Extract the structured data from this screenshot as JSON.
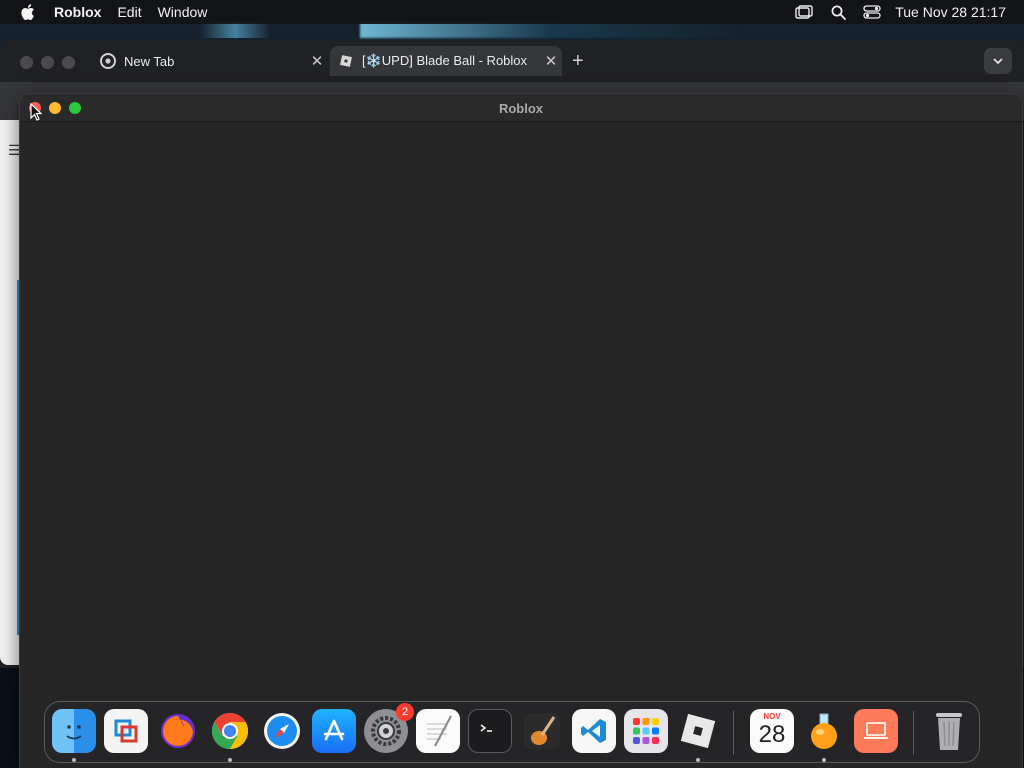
{
  "menubar": {
    "app_name": "Roblox",
    "menus": [
      "Edit",
      "Window"
    ],
    "clock": "Tue Nov 28  21:17"
  },
  "browser": {
    "tabs": [
      {
        "title": "New Tab",
        "active": false
      },
      {
        "title": "[❄️UPD] Blade Ball - Roblox",
        "active": true
      }
    ]
  },
  "roblox_window": {
    "title": "Roblox"
  },
  "dock": {
    "items": [
      {
        "name": "finder",
        "running": true
      },
      {
        "name": "vmware-fusion",
        "running": false
      },
      {
        "name": "firefox",
        "running": false
      },
      {
        "name": "chrome",
        "running": true
      },
      {
        "name": "safari",
        "running": false
      },
      {
        "name": "app-store",
        "running": false
      },
      {
        "name": "system-settings",
        "running": false,
        "badge": "2"
      },
      {
        "name": "textedit",
        "running": false
      },
      {
        "name": "terminal",
        "running": false
      },
      {
        "name": "garageband",
        "running": false
      },
      {
        "name": "vscode",
        "running": false
      },
      {
        "name": "launchpad",
        "running": false
      },
      {
        "name": "roblox",
        "running": true
      },
      {
        "name": "calendar",
        "running": false,
        "month": "NOV",
        "day": "28"
      },
      {
        "name": "reeder",
        "running": true
      },
      {
        "name": "screen-sharing",
        "running": false
      },
      {
        "name": "trash",
        "running": false
      }
    ]
  }
}
